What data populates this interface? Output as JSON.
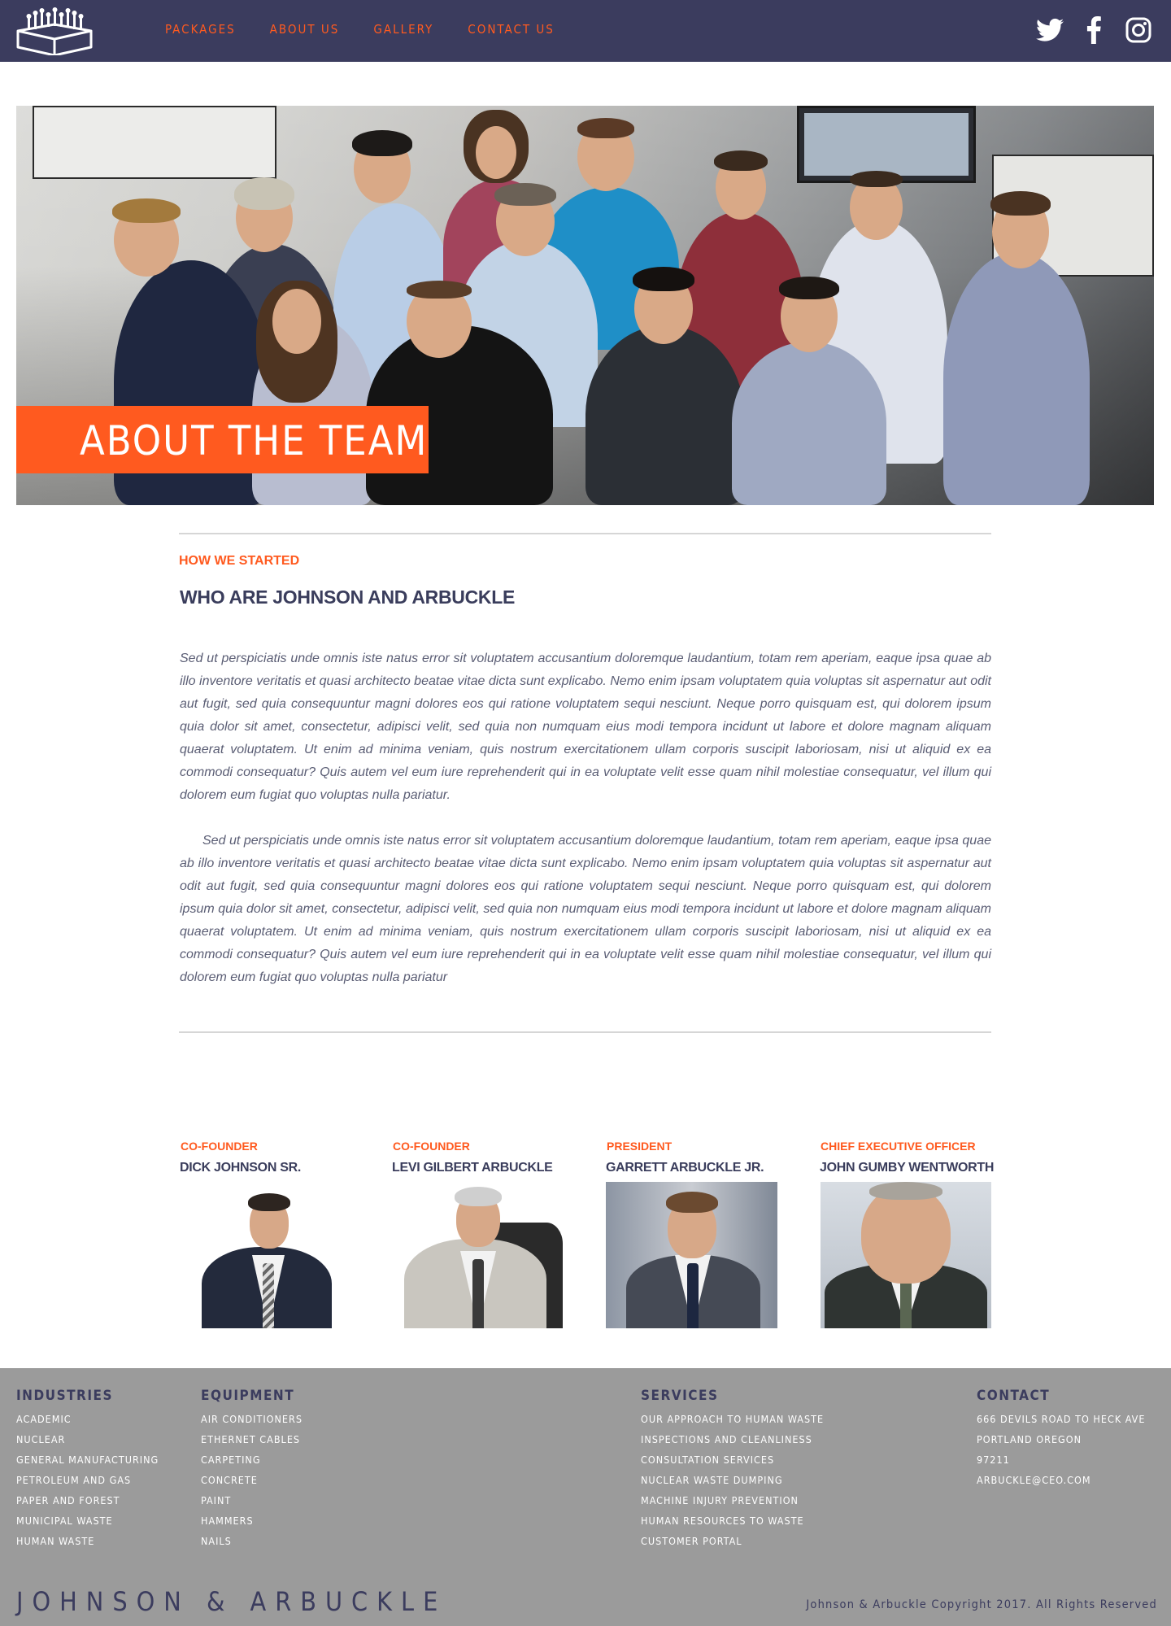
{
  "nav": {
    "logo_icon": "stage-box-logo-icon",
    "links": [
      {
        "label": "PACKAGES"
      },
      {
        "label": "ABOUT US"
      },
      {
        "label": "GALLERY"
      },
      {
        "label": "CONTACT US"
      }
    ],
    "social": [
      {
        "icon": "twitter-icon"
      },
      {
        "icon": "facebook-icon"
      },
      {
        "icon": "instagram-icon"
      }
    ]
  },
  "hero": {
    "title": "ABOUT THE TEAM",
    "banner_color": "#ff5a1f"
  },
  "story": {
    "eyebrow": "HOW WE STARTED",
    "title": "WHO ARE JOHNSON AND ARBUCKLE",
    "paragraphs": [
      "Sed ut perspiciatis unde omnis iste natus error sit voluptatem accusantium doloremque laudantium, totam rem aperiam, eaque ipsa quae ab illo inventore veritatis et quasi architecto beatae vitae dicta sunt explicabo. Nemo enim ipsam voluptatem quia voluptas sit aspernatur aut odit aut fugit, sed quia consequuntur magni dolores eos qui ratione voluptatem sequi nesciunt. Neque porro quisquam est, qui dolorem ipsum quia dolor sit amet, consectetur, adipisci velit, sed quia non numquam eius modi tempora incidunt ut labore et dolore magnam aliquam quaerat voluptatem. Ut enim ad minima veniam, quis nostrum exercitationem ullam corporis suscipit laboriosam, nisi ut aliquid ex ea commodi consequatur? Quis autem vel eum iure reprehenderit qui in ea voluptate velit esse quam nihil molestiae consequatur, vel illum qui dolorem eum fugiat quo voluptas nulla pariatur.",
      "Sed ut perspiciatis unde omnis iste natus error sit voluptatem accusantium doloremque laudantium, totam rem aperiam, eaque ipsa quae ab illo inventore veritatis et quasi architecto beatae vitae dicta sunt explicabo. Nemo enim ipsam voluptatem quia voluptas sit aspernatur aut odit aut fugit, sed quia consequuntur magni dolores eos qui ratione voluptatem sequi nesciunt. Neque porro quisquam est, qui dolorem ipsum quia dolor sit amet, consectetur, adipisci velit, sed quia non numquam eius modi tempora incidunt ut labore et dolore magnam aliquam quaerat voluptatem. Ut enim ad minima veniam, quis nostrum exercitationem ullam corporis suscipit laboriosam, nisi ut aliquid ex ea commodi consequatur? Quis autem vel eum iure reprehenderit qui in ea voluptate velit esse quam nihil molestiae consequatur, vel illum qui dolorem eum fugiat quo voluptas nulla pariatur"
    ]
  },
  "team": [
    {
      "role": "CO-FOUNDER",
      "name": "DICK JOHNSON SR."
    },
    {
      "role": "CO-FOUNDER",
      "name": "LEVI GILBERT ARBUCKLE"
    },
    {
      "role": "PRESIDENT",
      "name": "GARRETT ARBUCKLE JR."
    },
    {
      "role": "CHIEF EXECUTIVE OFFICER",
      "name": "JOHN GUMBY WENTWORTH"
    }
  ],
  "footer": {
    "industries": {
      "title": "INDUSTRIES",
      "items": [
        "ACADEMIC",
        "NUCLEAR",
        "GENERAL MANUFACTURING",
        "PETROLEUM AND GAS",
        "PAPER AND FOREST",
        "MUNICIPAL WASTE",
        "HUMAN WASTE"
      ]
    },
    "equipment": {
      "title": "EQUIPMENT",
      "items": [
        "AIR CONDITIONERS",
        "ETHERNET CABLES",
        "CARPETING",
        "CONCRETE",
        "PAINT",
        "HAMMERS",
        "NAILS"
      ]
    },
    "services": {
      "title": "SERVICES",
      "items": [
        "OUR APPROACH TO HUMAN WASTE",
        "INSPECTIONS AND CLEANLINESS",
        "CONSULTATION SERVICES",
        "NUCLEAR WASTE DUMPING",
        "MACHINE INJURY PREVENTION",
        "HUMAN RESOURCES TO WASTE",
        "CUSTOMER PORTAL"
      ]
    },
    "contact": {
      "title": "CONTACT",
      "items": [
        "666 DEVILS ROAD TO HECK AVE",
        "PORTLAND OREGON",
        "97211",
        "ARBUCKLE@CEO.COM"
      ]
    },
    "brand": "JOHNSON & ARBUCKLE",
    "copyright": "Johnson & Arbuckle Copyright 2017. All Rights Reserved"
  },
  "colors": {
    "navy": "#3b3c5e",
    "accent": "#ff5a1f",
    "footer_bg": "#9b9b9b"
  }
}
